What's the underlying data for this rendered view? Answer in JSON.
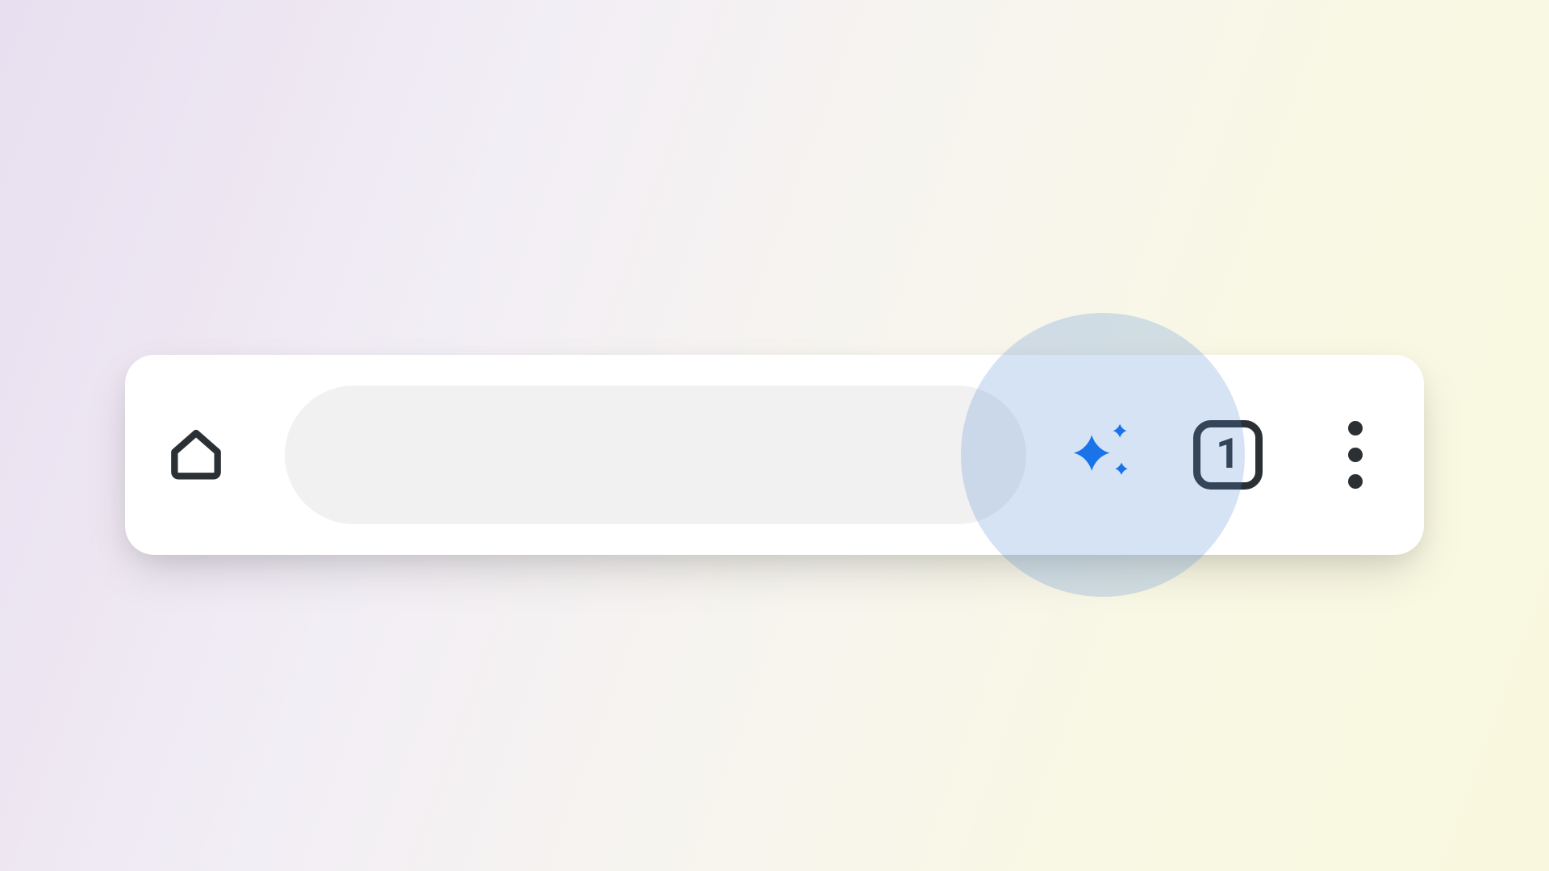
{
  "toolbar": {
    "home_icon": "home-icon",
    "address_value": "",
    "address_placeholder": "",
    "ai_icon": "sparkle-icon",
    "tabs_count": "1",
    "menu_icon": "more-vertical-icon"
  },
  "colors": {
    "sparkle": "#1a73e8",
    "icon_dark": "#2b3034",
    "highlight": "rgba(82,136,214,0.24)"
  }
}
